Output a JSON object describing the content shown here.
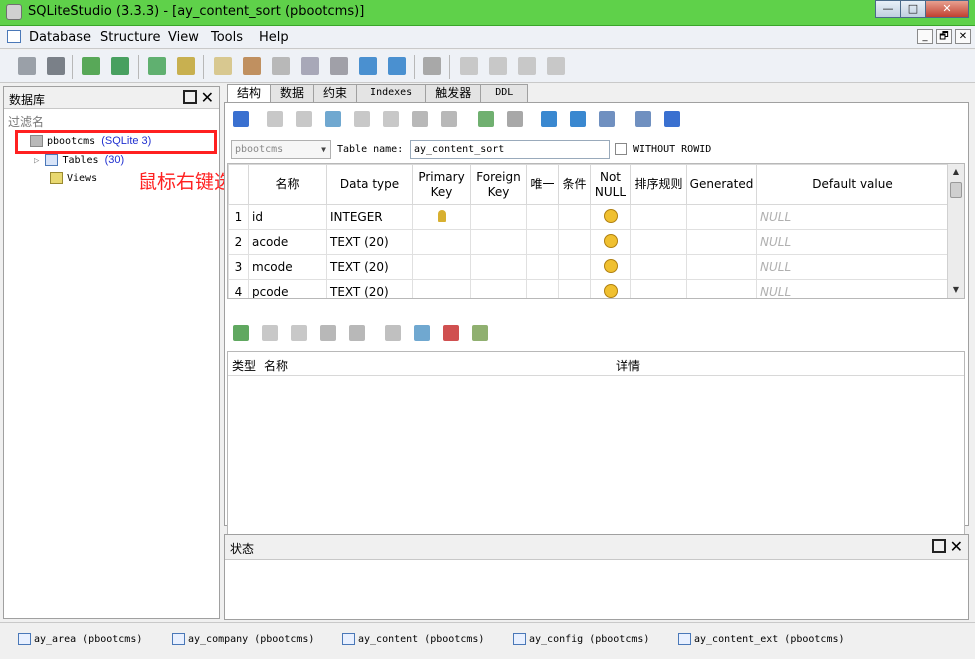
{
  "window": {
    "title": "SQLiteStudio (3.3.3) - [ay_content_sort (pbootcms)]",
    "minimize_label": "—",
    "maximize_label": "□",
    "close_label": "✕"
  },
  "menu": [
    "Database",
    "Structure",
    "View",
    "Tools",
    "Help"
  ],
  "mdi_controls": [
    "_",
    "🗗",
    "✕"
  ],
  "left_panel": {
    "title": "数据库",
    "filter_placeholder": "过滤名",
    "tree": {
      "db_name": "pbootcms",
      "db_type": "(SQLite 3)",
      "tables_label": "Tables",
      "tables_count": "(30)",
      "views_label": "Views"
    }
  },
  "annotation": "鼠标右键选择导出数据库",
  "tabs": [
    "结构",
    "数据",
    "约束",
    "Indexes",
    "触发器",
    "DDL"
  ],
  "structure": {
    "db_combo": "pbootcms",
    "table_name_label": "Table name:",
    "table_name_value": "ay_content_sort",
    "without_rowid_label": "WITHOUT ROWID",
    "columns_header": [
      "",
      "名称",
      "Data type",
      "Primary\nKey",
      "Foreign\nKey",
      "唯一",
      "条件",
      "Not\nNULL",
      "排序规则",
      "Generated",
      "Default value"
    ],
    "rows": [
      {
        "num": "1",
        "name": "id",
        "type": "INTEGER",
        "pk": true,
        "default": "NULL"
      },
      {
        "num": "2",
        "name": "acode",
        "type": "TEXT (20)",
        "pk": false,
        "default": "NULL"
      },
      {
        "num": "3",
        "name": "mcode",
        "type": "TEXT (20)",
        "pk": false,
        "default": "NULL"
      },
      {
        "num": "4",
        "name": "pcode",
        "type": "TEXT (20)",
        "pk": false,
        "default": "NULL"
      }
    ]
  },
  "constraints_header": {
    "type": "类型",
    "name": "名称",
    "details": "详情"
  },
  "status_panel": {
    "title": "状态"
  },
  "taskbar": [
    "ay_area (pbootcms)",
    "ay_company (pbootcms)",
    "ay_content (pbootcms)",
    "ay_config (pbootcms)",
    "ay_content_ext (pbootcms)"
  ],
  "colors": {
    "titlebar": "#5fd14a",
    "highlight": "#ff2020",
    "annotation": "#ff2020"
  }
}
